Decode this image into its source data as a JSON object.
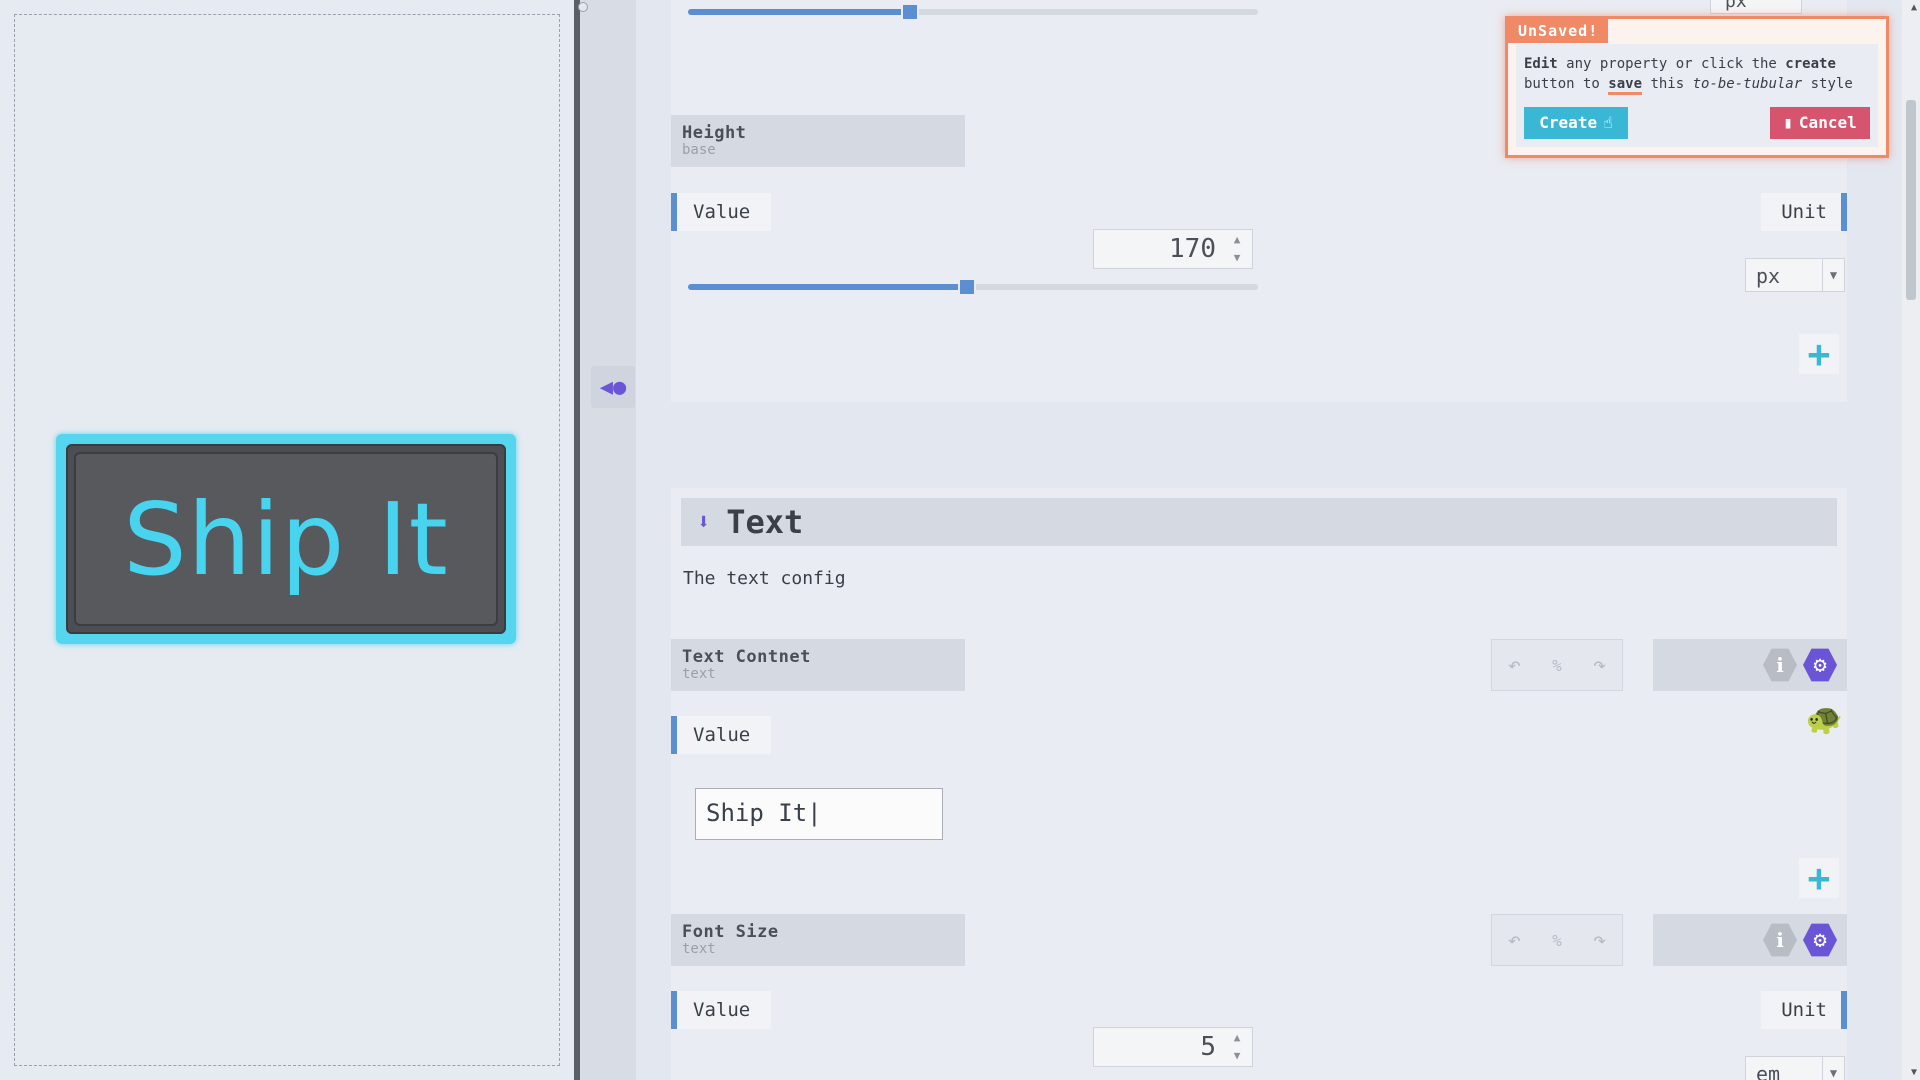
{
  "preview": {
    "button_text": "Ship It",
    "button_bg": "#58595d",
    "button_text_color": "#48d4ef",
    "button_border_color": "#56d6ee"
  },
  "sidebar_toggle": {
    "icon": "collapse-left-icon"
  },
  "size_section": {
    "width_slider_fraction": 0.39,
    "height": {
      "name": "Height",
      "sub": "base",
      "value_label": "Value",
      "unit_label": "Unit",
      "value": "170",
      "unit": "px",
      "slider_fraction": 0.49
    },
    "top_unit": "px"
  },
  "text_section": {
    "title": "Text",
    "description": "The text config",
    "content_prop": {
      "name": "Text Contnet",
      "sub": "text",
      "value_label": "Value",
      "value": "Ship It"
    },
    "font_size_prop": {
      "name": "Font Size",
      "sub": "text",
      "value_label": "Value",
      "unit_label": "Unit",
      "value": "5",
      "unit": "em"
    },
    "tools_percent": "%"
  },
  "unsaved": {
    "tab": "UnSaved!",
    "edit_word": "Edit",
    "msg_1": " any property or click the ",
    "create_word": "create",
    "msg_2": "button to ",
    "save_word": "save",
    "msg_3": " this ",
    "tubular": "to-be-tubular",
    "msg_4": " style",
    "create_label": "Create",
    "cancel_label": "Cancel",
    "accent": "#f08a66"
  },
  "colors": {
    "accent_blue": "#5b8fd0",
    "accent_cyan": "#3bb7d6",
    "accent_purple": "#6a55d6",
    "cancel_red": "#d6546e"
  }
}
